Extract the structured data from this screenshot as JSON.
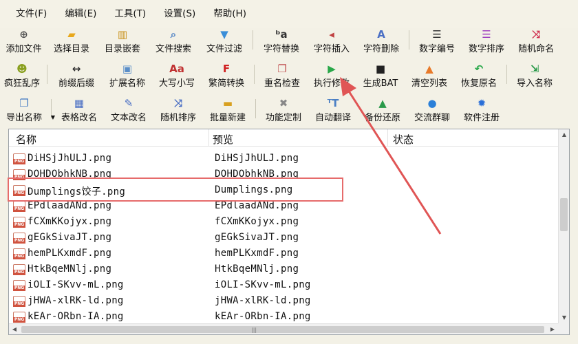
{
  "menu": [
    "文件(F)",
    "编辑(E)",
    "工具(T)",
    "设置(S)",
    "帮助(H)"
  ],
  "toolbar1": [
    {
      "label": "添加文件",
      "icon": "add-file-icon",
      "glyph": "⊕",
      "color": "#555"
    },
    {
      "label": "选择目录",
      "icon": "folder-icon",
      "glyph": "▰",
      "color": "#e8a81c"
    },
    {
      "label": "目录嵌套",
      "icon": "nested-folder-icon",
      "glyph": "▥",
      "color": "#c8901a"
    },
    {
      "label": "文件搜索",
      "icon": "search-icon",
      "glyph": "⌕",
      "color": "#4a7fc4"
    },
    {
      "label": "文件过滤",
      "icon": "filter-icon",
      "glyph": "▼",
      "color": "#3a8ed8"
    },
    {
      "sep": true
    },
    {
      "label": "字符替换",
      "icon": "replace-icon",
      "glyph": "ᵇa",
      "color": "#333"
    },
    {
      "label": "字符插入",
      "icon": "insert-icon",
      "glyph": "◂",
      "color": "#c04040"
    },
    {
      "label": "字符删除",
      "icon": "delete-icon",
      "glyph": "A",
      "color": "#4a6fc4"
    },
    {
      "sep": true
    },
    {
      "label": "数字编号",
      "icon": "numbering-icon",
      "glyph": "☰",
      "color": "#333"
    },
    {
      "label": "数字排序",
      "icon": "sort-icon",
      "glyph": "☰",
      "color": "#a040c0"
    },
    {
      "label": "随机命名",
      "icon": "shuffle-icon",
      "glyph": "⤨",
      "color": "#d03050"
    }
  ],
  "toolbar2": [
    {
      "label": "疯狂乱序",
      "icon": "crazy-shuffle-icon",
      "glyph": "☻",
      "color": "#8aa020"
    },
    {
      "sep": true
    },
    {
      "label": "前缀后缀",
      "icon": "prefix-suffix-icon",
      "glyph": "↔",
      "color": "#333"
    },
    {
      "label": "扩展名称",
      "icon": "extension-icon",
      "glyph": "▣",
      "color": "#5a8ec8"
    },
    {
      "label": "大写小写",
      "icon": "case-icon",
      "glyph": "Aa",
      "color": "#c03030"
    },
    {
      "label": "繁简转换",
      "icon": "convert-icon",
      "glyph": "F",
      "color": "#d02020"
    },
    {
      "sep": true
    },
    {
      "label": "重名检查",
      "icon": "duplicate-check-icon",
      "glyph": "❐",
      "color": "#c05050"
    },
    {
      "label": "执行修改",
      "icon": "play-icon",
      "glyph": "▶",
      "color": "#2aa84a"
    },
    {
      "label": "生成BAT",
      "icon": "terminal-icon",
      "glyph": "■",
      "color": "#222"
    },
    {
      "label": "清空列表",
      "icon": "clear-icon",
      "glyph": "▲",
      "color": "#e87a2a"
    },
    {
      "label": "恢复原名",
      "icon": "undo-icon",
      "glyph": "↶",
      "color": "#2aa84a"
    },
    {
      "sep": true
    },
    {
      "label": "导入名称",
      "icon": "import-icon",
      "glyph": "⇲",
      "color": "#2a9a4a"
    }
  ],
  "toolbar3": [
    {
      "label": "导出名称",
      "icon": "export-icon",
      "glyph": "❐",
      "color": "#4a7fc4",
      "caret": true
    },
    {
      "sep": true
    },
    {
      "label": "表格改名",
      "icon": "table-icon",
      "glyph": "▦",
      "color": "#4a6fc4"
    },
    {
      "label": "文本改名",
      "icon": "text-edit-icon",
      "glyph": "✎",
      "color": "#4a6fc4"
    },
    {
      "label": "随机排序",
      "icon": "random-sort-icon",
      "glyph": "⤨",
      "color": "#4a6fc4"
    },
    {
      "label": "批量新建",
      "icon": "batch-new-icon",
      "glyph": "▬",
      "color": "#d8a020"
    },
    {
      "sep": true
    },
    {
      "label": "功能定制",
      "icon": "tools-icon",
      "glyph": "✖",
      "color": "#888"
    },
    {
      "label": "自动翻译",
      "icon": "translate-icon",
      "glyph": "ᵀT",
      "color": "#4a7fc4"
    },
    {
      "label": "备份还原",
      "icon": "backup-icon",
      "glyph": "▲",
      "color": "#2a9a4a"
    },
    {
      "label": "交流群聊",
      "icon": "chat-icon",
      "glyph": "●",
      "color": "#2a7fd8"
    },
    {
      "label": "软件注册",
      "icon": "register-icon",
      "glyph": "✹",
      "color": "#2a6fd8"
    }
  ],
  "columns": {
    "name": "名称",
    "preview": "预览",
    "status": "状态"
  },
  "files": [
    {
      "name": "DiHSjJhULJ.png",
      "preview": "DiHSjJhULJ.png"
    },
    {
      "name": "DOHDObhkNB.png",
      "preview": "DOHDObhkNB.png"
    },
    {
      "name": "Dumplings饺子.png",
      "preview": "Dumplings.png"
    },
    {
      "name": "EPdlaadANd.png",
      "preview": "EPdlaadANd.png"
    },
    {
      "name": "fCXmKKojyx.png",
      "preview": "fCXmKKojyx.png"
    },
    {
      "name": "gEGkSivaJT.png",
      "preview": "gEGkSivaJT.png"
    },
    {
      "name": "hemPLKxmdF.png",
      "preview": "hemPLKxmdF.png"
    },
    {
      "name": "HtkBqeMNlj.png",
      "preview": "HtkBqeMNlj.png"
    },
    {
      "name": "iOLI-SKvv-mL.png",
      "preview": "iOLI-SKvv-mL.png"
    },
    {
      "name": "jHWA-xlRK-ld.png",
      "preview": "jHWA-xlRK-ld.png"
    },
    {
      "name": "kEAr-ORbn-IA.png",
      "preview": "kEAr-ORbn-IA.png"
    }
  ],
  "file_icon": "png-file-icon",
  "annotation_color": "#e05555"
}
